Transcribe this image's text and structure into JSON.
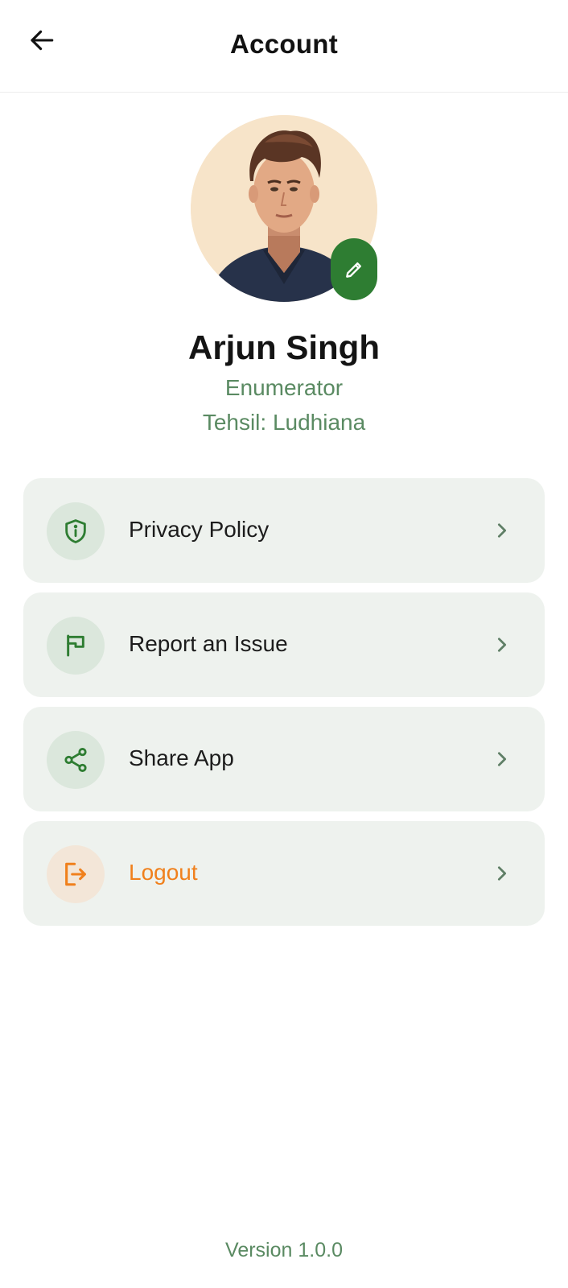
{
  "header": {
    "title": "Account"
  },
  "profile": {
    "name": "Arjun Singh",
    "role": "Enumerator",
    "tehsil": "Tehsil: Ludhiana"
  },
  "menu": {
    "items": [
      {
        "label": "Privacy Policy",
        "icon": "shield-info-icon"
      },
      {
        "label": "Report an Issue",
        "icon": "flag-icon"
      },
      {
        "label": "Share App",
        "icon": "share-icon"
      },
      {
        "label": "Logout",
        "icon": "logout-icon"
      }
    ]
  },
  "footer": {
    "version": "Version 1.0.0"
  },
  "colors": {
    "primary_green": "#2e7d32",
    "muted_green": "#5a8a62",
    "card_bg": "#eef2ee",
    "logout_orange": "#f0801c"
  }
}
